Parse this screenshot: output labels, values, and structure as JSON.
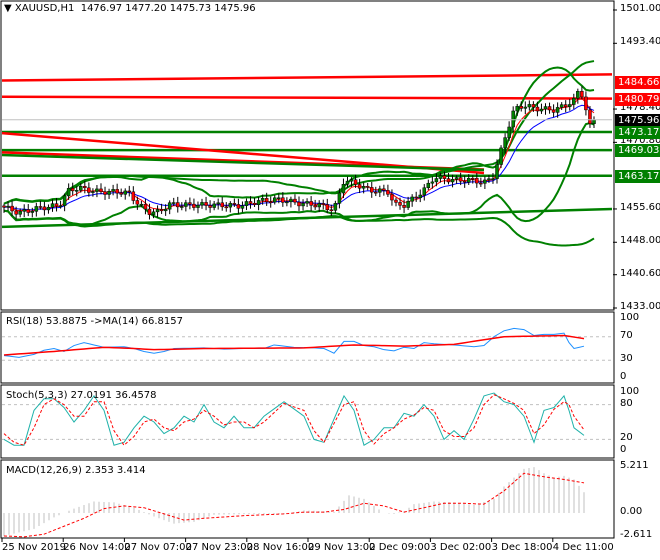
{
  "header": {
    "symbol": "XAUUSD,H1",
    "ohlc": "1476.97 1477.20 1475.73 1475.96"
  },
  "colors": {
    "red": "#ff0000",
    "green": "#008000",
    "blue": "#0000ff",
    "rsi": "#1e90ff",
    "stoch": "#20b2aa",
    "grid": "#c0c0c0",
    "hist": "#c0c0c0",
    "current": "#000000"
  },
  "price_axis": {
    "labels": [
      "1501.00",
      "1493.40",
      "1478.40",
      "1470.80",
      "1455.60",
      "1448.00",
      "1440.60",
      "1433.00"
    ]
  },
  "price_tags": [
    {
      "text": "1484.66",
      "color": "#ff0000"
    },
    {
      "text": "1480.79",
      "color": "#ff0000"
    },
    {
      "text": "1475.96",
      "color": "#000000"
    },
    {
      "text": "1473.17",
      "color": "#008000"
    },
    {
      "text": "1469.03",
      "color": "#008000"
    },
    {
      "text": "1463.17",
      "color": "#008000"
    }
  ],
  "time_axis": [
    "25 Nov 2019",
    "26 Nov 14:00",
    "27 Nov 07:00",
    "27 Nov 23:00",
    "28 Nov 16:00",
    "29 Nov 13:00",
    "2 Dec 09:00",
    "3 Dec 02:00",
    "3 Dec 18:00",
    "4 Dec 11:00"
  ],
  "rsi": {
    "title": "RSI(18) 53.8875  ->MA(14) 66.8157",
    "levels": [
      "100",
      "70",
      "30",
      "0"
    ]
  },
  "stoch": {
    "title": "Stoch(5,3,3) 27.0191 36.4578",
    "levels": [
      "100",
      "80",
      "20",
      "0"
    ]
  },
  "macd": {
    "title": "MACD(12,26,9) 2.353 3.414",
    "levels": [
      "5.211",
      "0.00",
      "-2.611"
    ]
  },
  "chart_data": [
    {
      "type": "candlestick",
      "title": "XAUUSD,H1",
      "ylim": [
        1433,
        1501
      ],
      "close_keypoints": [
        [
          0,
          1456.0
        ],
        [
          1.5,
          1454.7
        ],
        [
          3.5,
          1455.8
        ],
        [
          5.5,
          1456.4
        ],
        [
          6.5,
          1459.9
        ],
        [
          7.5,
          1460.4
        ],
        [
          8.5,
          1459.9
        ],
        [
          9.5,
          1459.5
        ],
        [
          11.5,
          1459.5
        ],
        [
          12.5,
          1459.2
        ],
        [
          13.5,
          1456.5
        ],
        [
          14.5,
          1454.9
        ],
        [
          15.5,
          1454.9
        ],
        [
          16.5,
          1456.7
        ],
        [
          17.5,
          1456.5
        ],
        [
          19.5,
          1456.5
        ],
        [
          21.5,
          1456.5
        ],
        [
          23.5,
          1456.3
        ],
        [
          25.5,
          1457.4
        ],
        [
          27.5,
          1457.8
        ],
        [
          29.5,
          1456.9
        ],
        [
          31.5,
          1456.5
        ],
        [
          33,
          1455.4
        ],
        [
          34,
          1462.2
        ],
        [
          35,
          1461.5
        ],
        [
          36.5,
          1459.9
        ],
        [
          38.5,
          1459.5
        ],
        [
          39,
          1456.5
        ],
        [
          40,
          1456.5
        ],
        [
          41,
          1458.1
        ],
        [
          42,
          1459.9
        ],
        [
          43,
          1462.8
        ],
        [
          45,
          1462.2
        ],
        [
          47,
          1462.2
        ],
        [
          48,
          1461.5
        ],
        [
          49,
          1463.3
        ],
        [
          50,
          1471.3
        ],
        [
          51,
          1478.2
        ],
        [
          52,
          1479.3
        ],
        [
          53,
          1478.6
        ],
        [
          55,
          1478.2
        ],
        [
          56,
          1479.1
        ],
        [
          57,
          1480.4
        ],
        [
          57.5,
          1482.7
        ],
        [
          58,
          1481.0
        ],
        [
          58.5,
          1474.1
        ],
        [
          59,
          1475.96
        ]
      ],
      "levels": [
        {
          "name": "resistance-trend-1",
          "color": "#ff0000",
          "from": 1484.9,
          "to": 1486.3
        },
        {
          "name": "resistance-1480",
          "color": "#ff0000",
          "from": 1481.2,
          "to": 1480.79
        },
        {
          "name": "support-1473",
          "color": "#008000",
          "from": 1473.17,
          "to": 1473.17
        },
        {
          "name": "support-1469",
          "color": "#008000",
          "from": 1469.03,
          "to": 1469.03
        },
        {
          "name": "support-1463",
          "color": "#008000",
          "from": 1463.17,
          "to": 1463.17
        },
        {
          "name": "support-trend-low",
          "color": "#008000",
          "from": 1451.5,
          "to": 1455.6
        },
        {
          "name": "red-down-trend-1",
          "color": "#ff0000",
          "from": 1472.9,
          "to": 1463.8,
          "end": 48
        },
        {
          "name": "red-down-trend-2",
          "color": "#ff0000",
          "from": 1468.5,
          "to": 1464.6,
          "end": 48
        },
        {
          "name": "green-down-trend",
          "color": "#008000",
          "from": 1467.9,
          "to": 1464.5,
          "end": 48
        }
      ]
    },
    {
      "type": "line",
      "name": "RSI",
      "ylim": [
        0,
        100
      ],
      "levels": [
        70,
        30
      ],
      "rsi": [
        [
          0,
          38
        ],
        [
          1.5,
          35
        ],
        [
          3,
          40
        ],
        [
          4,
          47
        ],
        [
          5,
          50
        ],
        [
          6,
          45
        ],
        [
          7,
          55
        ],
        [
          8,
          60
        ],
        [
          9,
          56
        ],
        [
          10,
          52
        ],
        [
          12,
          53
        ],
        [
          13,
          50
        ],
        [
          14,
          45
        ],
        [
          15,
          42
        ],
        [
          16,
          45
        ],
        [
          17,
          50
        ],
        [
          20,
          51
        ],
        [
          22,
          49
        ],
        [
          24,
          50
        ],
        [
          26,
          50
        ],
        [
          27,
          56
        ],
        [
          29,
          52
        ],
        [
          31,
          51
        ],
        [
          32,
          50
        ],
        [
          33,
          42
        ],
        [
          34,
          62
        ],
        [
          35,
          62
        ],
        [
          36,
          55
        ],
        [
          37,
          53
        ],
        [
          38,
          48
        ],
        [
          39,
          46
        ],
        [
          40,
          52
        ],
        [
          41,
          50
        ],
        [
          42,
          60
        ],
        [
          43,
          58
        ],
        [
          45,
          56
        ],
        [
          47,
          53
        ],
        [
          48,
          55
        ],
        [
          49,
          70
        ],
        [
          50,
          80
        ],
        [
          51,
          84
        ],
        [
          52,
          82
        ],
        [
          53,
          72
        ],
        [
          54,
          74
        ],
        [
          55,
          74
        ],
        [
          56,
          76
        ],
        [
          56.5,
          60
        ],
        [
          57,
          50
        ],
        [
          58,
          53.9
        ]
      ],
      "ma": [
        [
          0,
          39
        ],
        [
          5,
          45
        ],
        [
          10,
          52
        ],
        [
          13,
          50
        ],
        [
          15,
          48
        ],
        [
          20,
          50
        ],
        [
          30,
          51
        ],
        [
          35,
          56
        ],
        [
          40,
          54
        ],
        [
          45,
          57
        ],
        [
          50,
          70
        ],
        [
          56,
          72
        ],
        [
          58,
          66.8
        ]
      ]
    },
    {
      "type": "line",
      "name": "Stochastic",
      "ylim": [
        0,
        100
      ],
      "levels": [
        80,
        20
      ],
      "main": [
        [
          0,
          20
        ],
        [
          1,
          10
        ],
        [
          2,
          10
        ],
        [
          3,
          70
        ],
        [
          4,
          90
        ],
        [
          5,
          90
        ],
        [
          6,
          75
        ],
        [
          7,
          50
        ],
        [
          8,
          70
        ],
        [
          9,
          95
        ],
        [
          10,
          70
        ],
        [
          11,
          10
        ],
        [
          12,
          15
        ],
        [
          13,
          40
        ],
        [
          14,
          60
        ],
        [
          15,
          50
        ],
        [
          16,
          30
        ],
        [
          17,
          40
        ],
        [
          18,
          60
        ],
        [
          19,
          50
        ],
        [
          20,
          80
        ],
        [
          21,
          50
        ],
        [
          22,
          40
        ],
        [
          23,
          60
        ],
        [
          24,
          40
        ],
        [
          25,
          40
        ],
        [
          26,
          60
        ],
        [
          28,
          85
        ],
        [
          30,
          60
        ],
        [
          31,
          20
        ],
        [
          32,
          15
        ],
        [
          34,
          95
        ],
        [
          35,
          70
        ],
        [
          36,
          10
        ],
        [
          37,
          20
        ],
        [
          38,
          40
        ],
        [
          39,
          40
        ],
        [
          40,
          65
        ],
        [
          41,
          60
        ],
        [
          42,
          80
        ],
        [
          43,
          60
        ],
        [
          44,
          20
        ],
        [
          45,
          35
        ],
        [
          46,
          20
        ],
        [
          47,
          55
        ],
        [
          48,
          95
        ],
        [
          49,
          100
        ],
        [
          50,
          85
        ],
        [
          51,
          80
        ],
        [
          52,
          60
        ],
        [
          53,
          15
        ],
        [
          54,
          70
        ],
        [
          55,
          75
        ],
        [
          56,
          95
        ],
        [
          56.5,
          70
        ],
        [
          57,
          40
        ],
        [
          58,
          27
        ]
      ],
      "signal": [
        [
          0,
          30
        ],
        [
          1,
          15
        ],
        [
          2,
          10
        ],
        [
          3,
          40
        ],
        [
          4,
          80
        ],
        [
          5,
          90
        ],
        [
          6,
          80
        ],
        [
          7,
          60
        ],
        [
          8,
          60
        ],
        [
          9,
          85
        ],
        [
          10,
          85
        ],
        [
          11,
          35
        ],
        [
          12,
          10
        ],
        [
          13,
          25
        ],
        [
          14,
          50
        ],
        [
          15,
          55
        ],
        [
          16,
          40
        ],
        [
          17,
          35
        ],
        [
          18,
          50
        ],
        [
          19,
          55
        ],
        [
          20,
          70
        ],
        [
          21,
          60
        ],
        [
          22,
          45
        ],
        [
          23,
          50
        ],
        [
          24,
          50
        ],
        [
          25,
          40
        ],
        [
          26,
          50
        ],
        [
          28,
          82
        ],
        [
          30,
          70
        ],
        [
          31,
          35
        ],
        [
          32,
          15
        ],
        [
          34,
          80
        ],
        [
          35,
          85
        ],
        [
          36,
          35
        ],
        [
          37,
          12
        ],
        [
          38,
          30
        ],
        [
          39,
          40
        ],
        [
          40,
          55
        ],
        [
          41,
          62
        ],
        [
          42,
          75
        ],
        [
          43,
          70
        ],
        [
          44,
          35
        ],
        [
          45,
          25
        ],
        [
          46,
          25
        ],
        [
          47,
          40
        ],
        [
          48,
          80
        ],
        [
          49,
          97
        ],
        [
          50,
          90
        ],
        [
          51,
          82
        ],
        [
          52,
          70
        ],
        [
          53,
          30
        ],
        [
          54,
          45
        ],
        [
          55,
          72
        ],
        [
          56,
          85
        ],
        [
          56.5,
          80
        ],
        [
          57,
          60
        ],
        [
          58,
          36.5
        ]
      ]
    },
    {
      "type": "bar+line",
      "name": "MACD",
      "ylim": [
        -2.611,
        5.211
      ],
      "histogram": [
        [
          0,
          -2.6
        ],
        [
          3,
          -1.8
        ],
        [
          5,
          -0.5
        ],
        [
          7,
          0.5
        ],
        [
          9,
          1.3
        ],
        [
          11,
          1.2
        ],
        [
          13,
          0.6
        ],
        [
          15,
          -0.4
        ],
        [
          17,
          -1.2
        ],
        [
          19,
          -1.0
        ],
        [
          21,
          -0.2
        ],
        [
          25,
          -0.1
        ],
        [
          28,
          -0.1
        ],
        [
          30,
          0.3
        ],
        [
          32,
          0.2
        ],
        [
          33,
          0.1
        ],
        [
          34.5,
          2.0
        ],
        [
          36,
          1.6
        ],
        [
          37,
          0.8
        ],
        [
          38,
          0
        ],
        [
          39,
          -0.1
        ],
        [
          40,
          0.2
        ],
        [
          41,
          1.0
        ],
        [
          43,
          1.3
        ],
        [
          45,
          1.2
        ],
        [
          47,
          0.9
        ],
        [
          49,
          1.6
        ],
        [
          50,
          3.0
        ],
        [
          51,
          4.0
        ],
        [
          52,
          5.0
        ],
        [
          53,
          5.2
        ],
        [
          54,
          4.5
        ],
        [
          55,
          4.0
        ],
        [
          56,
          4.2
        ],
        [
          57,
          3.8
        ],
        [
          58,
          2.353
        ]
      ],
      "signal": [
        [
          0,
          -2.6
        ],
        [
          2,
          -2.7
        ],
        [
          4,
          -2.4
        ],
        [
          6,
          -1.5
        ],
        [
          8,
          -0.6
        ],
        [
          10,
          0.5
        ],
        [
          12,
          0.8
        ],
        [
          14,
          0.6
        ],
        [
          16,
          -0.1
        ],
        [
          18,
          -0.8
        ],
        [
          20,
          -0.6
        ],
        [
          24,
          -0.3
        ],
        [
          28,
          -0.1
        ],
        [
          30,
          0.1
        ],
        [
          32,
          0.1
        ],
        [
          34,
          0.4
        ],
        [
          36,
          1.1
        ],
        [
          38,
          0.8
        ],
        [
          40,
          0.1
        ],
        [
          42,
          0.6
        ],
        [
          44,
          1.1
        ],
        [
          46,
          1.1
        ],
        [
          48,
          1.0
        ],
        [
          50,
          2.5
        ],
        [
          52,
          4.5
        ],
        [
          54,
          4.1
        ],
        [
          56,
          3.8
        ],
        [
          58,
          3.414
        ]
      ]
    }
  ]
}
